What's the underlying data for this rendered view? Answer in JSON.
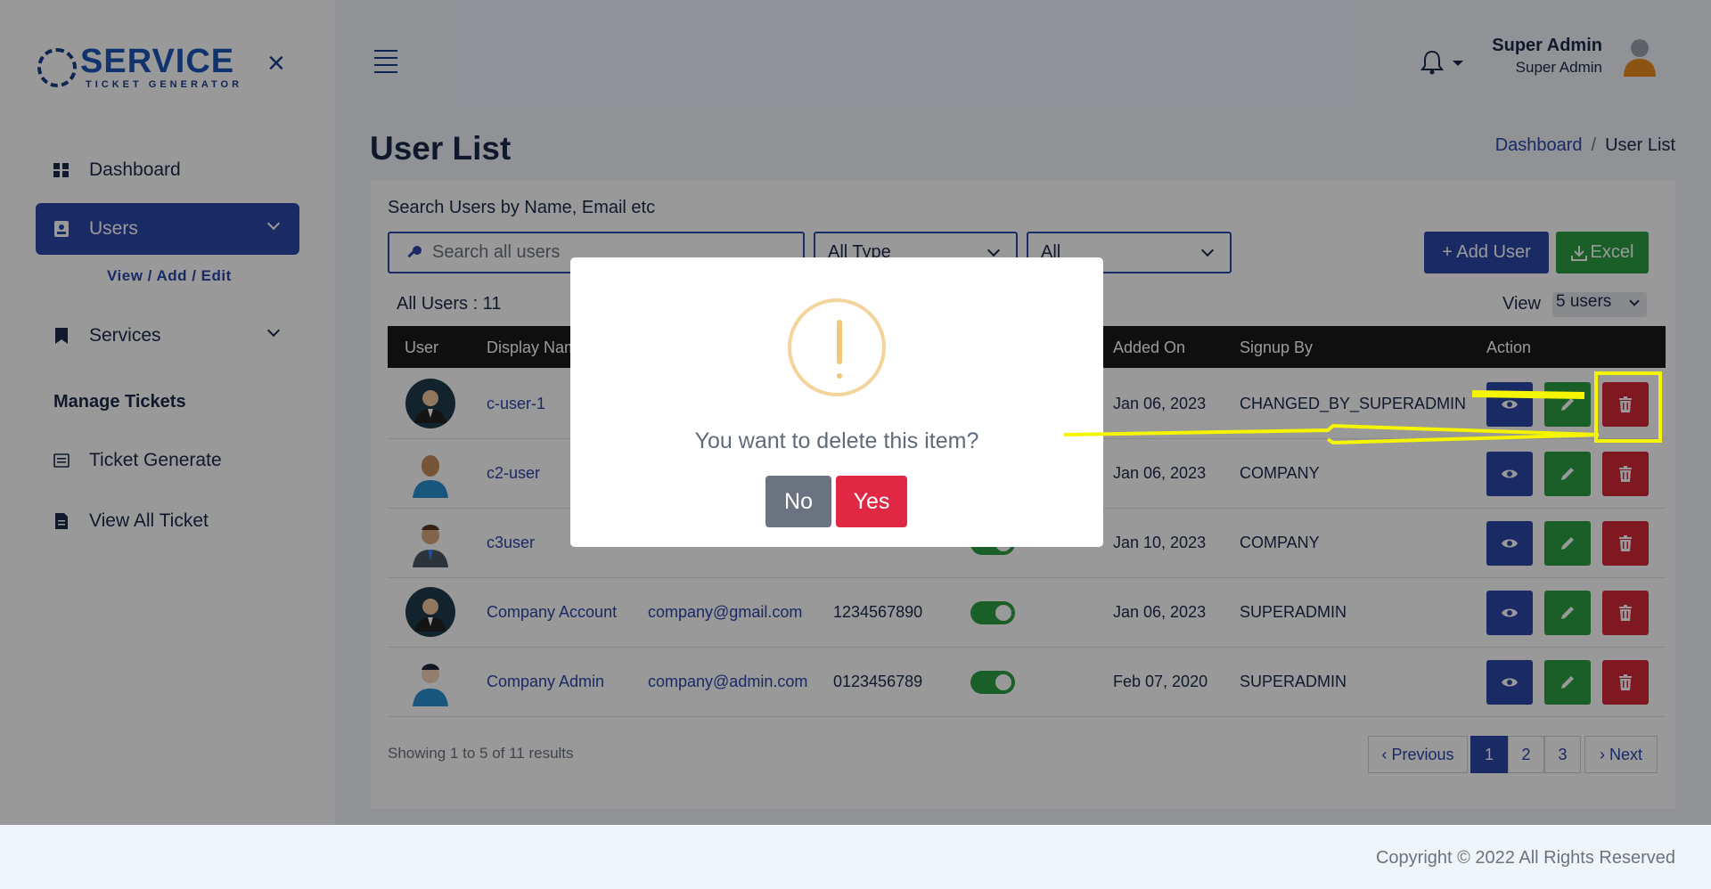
{
  "brand": {
    "name": "SERVICE",
    "tagline": "TICKET GENERATOR"
  },
  "sidebar": {
    "items": [
      {
        "label": "Dashboard",
        "icon": "grid-icon"
      },
      {
        "label": "Users",
        "icon": "user-card-icon",
        "active": true
      },
      {
        "label": "Services",
        "icon": "bookmark-icon"
      },
      {
        "label": "Ticket Generate",
        "icon": "list-icon"
      },
      {
        "label": "View All Ticket",
        "icon": "document-icon"
      }
    ],
    "users_sub": "View / Add / Edit",
    "manage_tickets": "Manage Tickets"
  },
  "header": {
    "user_name": "Super Admin",
    "user_role": "Super Admin"
  },
  "page": {
    "title": "User List",
    "breadcrumb": [
      "Dashboard",
      "/",
      "User List"
    ]
  },
  "filters": {
    "search_label": "Search Users by Name, Email etc",
    "search_placeholder": "Search all users",
    "type_select": "All Type",
    "status_select": "All",
    "add_user": "+ Add User",
    "excel": "Excel"
  },
  "table": {
    "count_label": "All Users : 11",
    "view_label": "View",
    "view_value": "5 users",
    "columns": [
      "User",
      "Display Name",
      "Added On",
      "Signup By",
      "Action"
    ],
    "rows": [
      {
        "display_name": "c-user-1",
        "email": "",
        "phone": "",
        "added_on": "Jan 06, 2023",
        "signup_by": "CHANGED_BY_SUPERADMIN"
      },
      {
        "display_name": "c2-user",
        "email": "",
        "phone": "",
        "added_on": "Jan 06, 2023",
        "signup_by": "COMPANY"
      },
      {
        "display_name": "c3user",
        "email": "",
        "phone": "",
        "added_on": "Jan 10, 2023",
        "signup_by": "COMPANY"
      },
      {
        "display_name": "Company Account",
        "email": "company@gmail.com",
        "phone": "1234567890",
        "added_on": "Jan 06, 2023",
        "signup_by": "SUPERADMIN"
      },
      {
        "display_name": "Company Admin",
        "email": "company@admin.com",
        "phone": "0123456789",
        "added_on": "Feb 07, 2020",
        "signup_by": "SUPERADMIN"
      }
    ]
  },
  "pagination": {
    "info": "Showing 1 to 5 of 11 results",
    "previous": "‹ Previous",
    "pages": [
      "1",
      "2",
      "3"
    ],
    "next": "› Next"
  },
  "footer": {
    "copyright": "Copyright © 2022 All Rights Reserved"
  },
  "modal": {
    "message": "You want to delete this item?",
    "no": "No",
    "yes": "Yes"
  },
  "colors": {
    "primary": "#2b46a8",
    "success": "#2e9e44",
    "danger": "#d6283a",
    "warning": "#f3c77a",
    "annotation": "#f5f500"
  }
}
